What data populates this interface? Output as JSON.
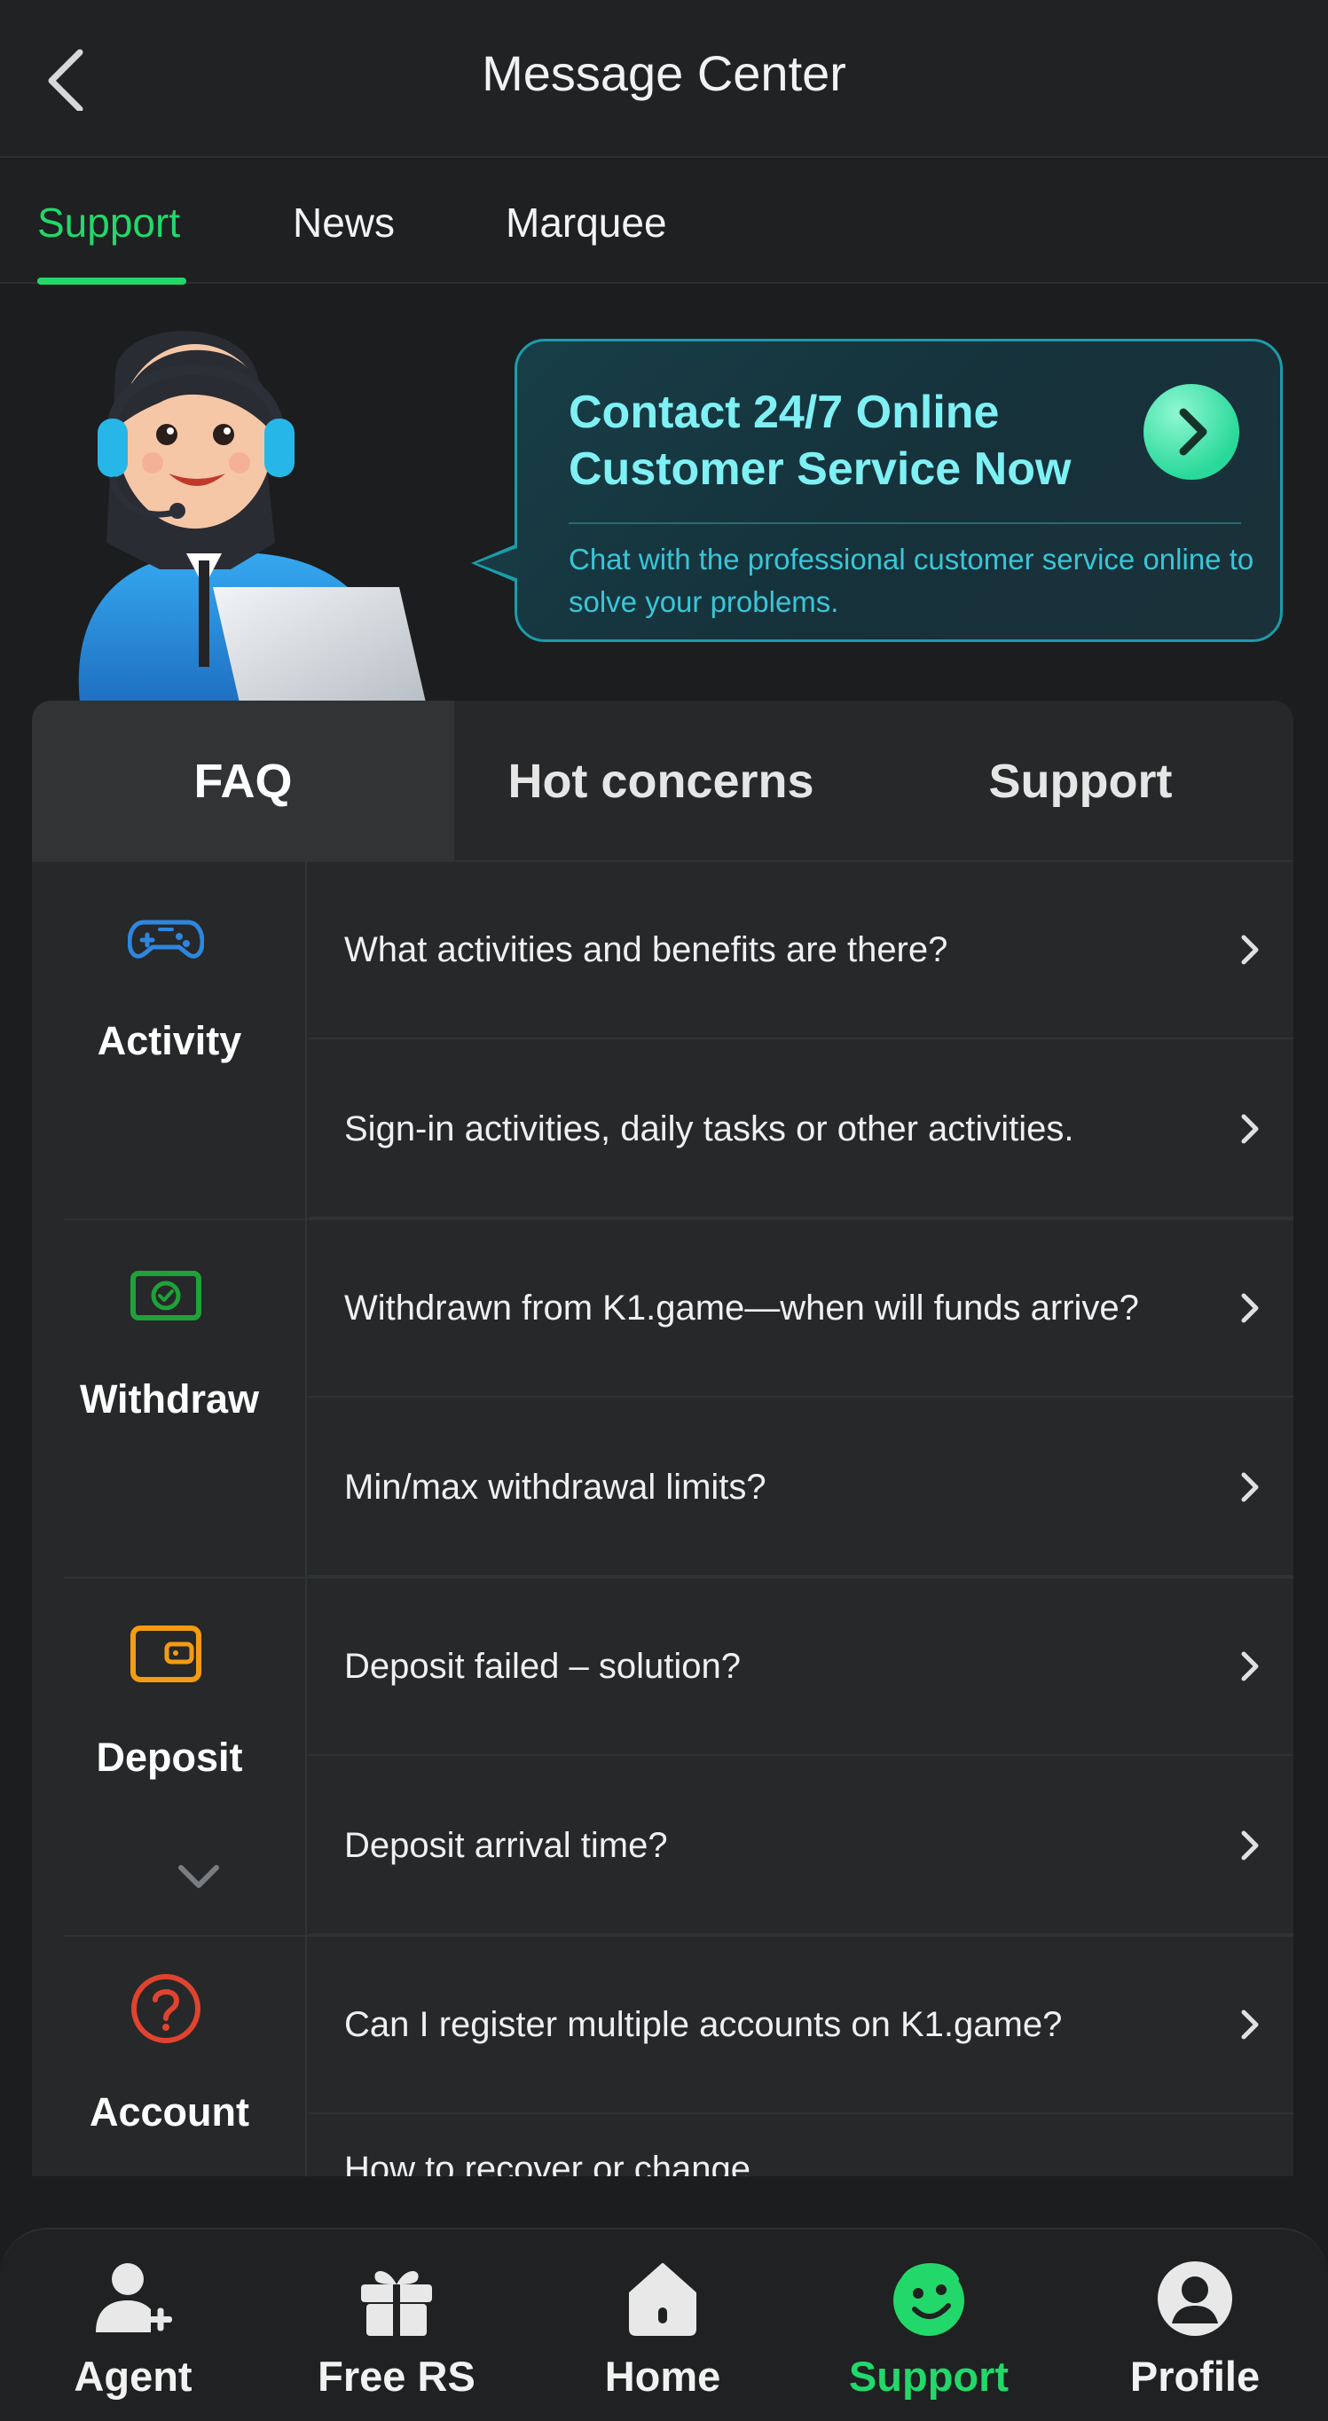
{
  "header": {
    "title": "Message Center"
  },
  "top_tabs": [
    {
      "label": "Support",
      "active": true
    },
    {
      "label": "News",
      "active": false
    },
    {
      "label": "Marquee",
      "active": false
    }
  ],
  "banner": {
    "title": "Contact 24/7 Online Customer Service Now",
    "description": "Chat with the professional customer service online to solve your problems."
  },
  "faq_tabs": [
    {
      "label": "FAQ",
      "active": true
    },
    {
      "label": "Hot concerns",
      "active": false
    },
    {
      "label": "Support",
      "active": false
    }
  ],
  "categories": [
    {
      "label": "Activity",
      "icon": "gamepad-icon",
      "color": "#2e86de",
      "questions": [
        "What activities and benefits are there?",
        "Sign-in activities, daily tasks or other activities."
      ]
    },
    {
      "label": "Withdraw",
      "icon": "cash-icon",
      "color": "#1fa13a",
      "questions": [
        "Withdrawn from K1.game—when will funds arrive?",
        "Min/max withdrawal limits?"
      ]
    },
    {
      "label": "Deposit",
      "icon": "wallet-icon",
      "color": "#f39c12",
      "questions": [
        "Deposit failed – solution?",
        "Deposit arrival time?"
      ]
    },
    {
      "label": "Account",
      "icon": "question-circle-icon",
      "color": "#e0432f",
      "questions": [
        "Can I register multiple accounts on K1.game?",
        "How to recover or change"
      ]
    }
  ],
  "bottom_nav": [
    {
      "label": "Agent",
      "icon": "agent-icon",
      "active": false
    },
    {
      "label": "Free RS",
      "icon": "gift-icon",
      "active": false
    },
    {
      "label": "Home",
      "icon": "home-icon",
      "active": false
    },
    {
      "label": "Support",
      "icon": "support-icon",
      "active": true
    },
    {
      "label": "Profile",
      "icon": "profile-icon",
      "active": false
    }
  ],
  "colors": {
    "accent": "#22d86a",
    "banner_border": "#1b9cab",
    "banner_title": "#7ff0f4"
  }
}
